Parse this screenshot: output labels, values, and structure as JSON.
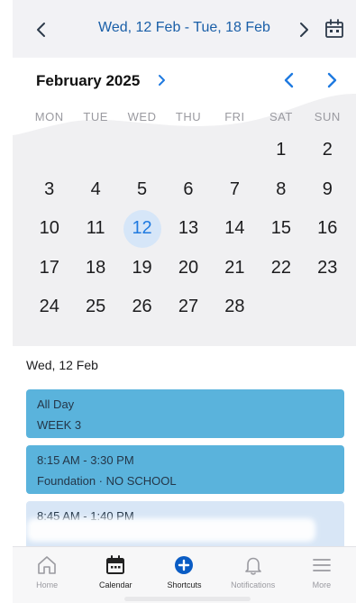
{
  "header": {
    "range_title": "Wed, 12 Feb - Tue, 18 Feb",
    "prev_icon": "chevron-left-icon",
    "next_icon": "chevron-right-icon",
    "calendar_icon": "calendar-icon"
  },
  "month": {
    "title": "February 2025",
    "weekdays": [
      "MON",
      "TUE",
      "WED",
      "THU",
      "FRI",
      "SAT",
      "SUN"
    ],
    "leading_blanks": 5,
    "days": [
      "1",
      "2",
      "3",
      "4",
      "5",
      "6",
      "7",
      "8",
      "9",
      "10",
      "11",
      "12",
      "13",
      "14",
      "15",
      "16",
      "17",
      "18",
      "19",
      "20",
      "21",
      "22",
      "23",
      "24",
      "25",
      "26",
      "27",
      "28"
    ],
    "selected_day": "12",
    "accent_color": "#1f7ae0"
  },
  "agenda": {
    "date_label": "Wed, 12 Feb",
    "events": [
      {
        "line1": "All Day",
        "line2": "WEEK 3",
        "color": "#5ab3dc"
      },
      {
        "line1": "8:15 AM - 3:30 PM",
        "line2": "Foundation · NO SCHOOL",
        "color": "#5ab3dc"
      },
      {
        "line1": "8:45 AM - 1:40 PM",
        "line2": "",
        "color": "#d8e6f6"
      }
    ]
  },
  "tabbar": {
    "tabs": [
      {
        "label": "Home",
        "icon": "home-icon",
        "active": false
      },
      {
        "label": "Calendar",
        "icon": "calendar-icon",
        "active": true
      },
      {
        "label": "Shortcuts",
        "icon": "plus-circle-icon",
        "active": true
      },
      {
        "label": "Notifications",
        "icon": "bell-icon",
        "active": false
      },
      {
        "label": "More",
        "icon": "menu-icon",
        "active": false
      }
    ]
  }
}
